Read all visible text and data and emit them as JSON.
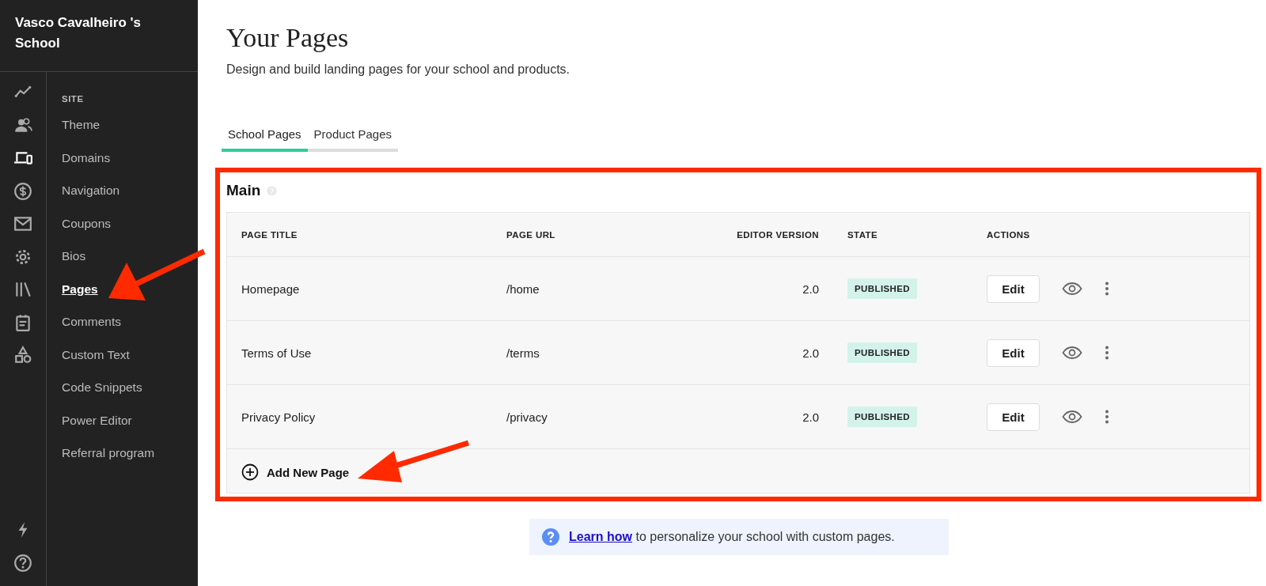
{
  "sidebar": {
    "school_name": "Vasco Cavalheiro 's School",
    "rail_items": [
      {
        "selected": false
      },
      {
        "selected": false
      },
      {
        "selected": true
      },
      {
        "selected": false
      },
      {
        "selected": false
      },
      {
        "selected": false
      },
      {
        "selected": false
      },
      {
        "selected": false
      },
      {
        "selected": false
      }
    ],
    "section_label": "SITE",
    "items": [
      {
        "label": "Theme",
        "selected": false
      },
      {
        "label": "Domains",
        "selected": false
      },
      {
        "label": "Navigation",
        "selected": false
      },
      {
        "label": "Coupons",
        "selected": false
      },
      {
        "label": "Bios",
        "selected": false
      },
      {
        "label": "Pages",
        "selected": true
      },
      {
        "label": "Comments",
        "selected": false
      },
      {
        "label": "Custom Text",
        "selected": false
      },
      {
        "label": "Code Snippets",
        "selected": false
      },
      {
        "label": "Power Editor",
        "selected": false
      },
      {
        "label": "Referral program",
        "selected": false
      }
    ]
  },
  "page": {
    "title": "Your Pages",
    "subtitle": "Design and build landing pages for your school and products."
  },
  "tabs": [
    {
      "label": "School Pages",
      "selected": true
    },
    {
      "label": "Product Pages",
      "selected": false
    }
  ],
  "panel": {
    "title": "Main",
    "table": {
      "columns": [
        "PAGE TITLE",
        "PAGE URL",
        "EDITOR VERSION",
        "STATE",
        "ACTIONS"
      ],
      "rows": [
        {
          "title": "Homepage",
          "url": "/home",
          "version": "2.0",
          "state": "PUBLISHED",
          "action": "Edit"
        },
        {
          "title": "Terms of Use",
          "url": "/terms",
          "version": "2.0",
          "state": "PUBLISHED",
          "action": "Edit"
        },
        {
          "title": "Privacy Policy",
          "url": "/privacy",
          "version": "2.0",
          "state": "PUBLISHED",
          "action": "Edit"
        }
      ]
    },
    "add_button": "Add New Page"
  },
  "info": {
    "link": "Learn how",
    "text": "to personalize your school with custom pages."
  }
}
